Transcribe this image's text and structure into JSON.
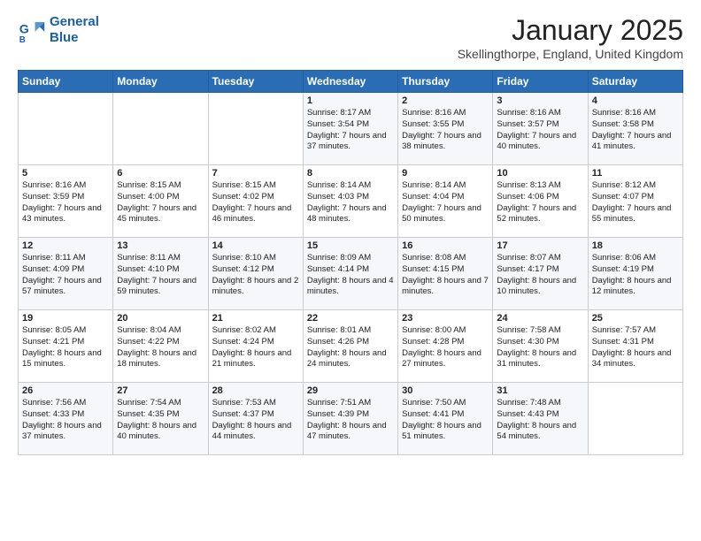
{
  "header": {
    "logo_line1": "General",
    "logo_line2": "Blue",
    "month": "January 2025",
    "location": "Skellingthorpe, England, United Kingdom"
  },
  "days_of_week": [
    "Sunday",
    "Monday",
    "Tuesday",
    "Wednesday",
    "Thursday",
    "Friday",
    "Saturday"
  ],
  "weeks": [
    [
      {
        "day": "",
        "text": ""
      },
      {
        "day": "",
        "text": ""
      },
      {
        "day": "",
        "text": ""
      },
      {
        "day": "1",
        "text": "Sunrise: 8:17 AM\nSunset: 3:54 PM\nDaylight: 7 hours and 37 minutes."
      },
      {
        "day": "2",
        "text": "Sunrise: 8:16 AM\nSunset: 3:55 PM\nDaylight: 7 hours and 38 minutes."
      },
      {
        "day": "3",
        "text": "Sunrise: 8:16 AM\nSunset: 3:57 PM\nDaylight: 7 hours and 40 minutes."
      },
      {
        "day": "4",
        "text": "Sunrise: 8:16 AM\nSunset: 3:58 PM\nDaylight: 7 hours and 41 minutes."
      }
    ],
    [
      {
        "day": "5",
        "text": "Sunrise: 8:16 AM\nSunset: 3:59 PM\nDaylight: 7 hours and 43 minutes."
      },
      {
        "day": "6",
        "text": "Sunrise: 8:15 AM\nSunset: 4:00 PM\nDaylight: 7 hours and 45 minutes."
      },
      {
        "day": "7",
        "text": "Sunrise: 8:15 AM\nSunset: 4:02 PM\nDaylight: 7 hours and 46 minutes."
      },
      {
        "day": "8",
        "text": "Sunrise: 8:14 AM\nSunset: 4:03 PM\nDaylight: 7 hours and 48 minutes."
      },
      {
        "day": "9",
        "text": "Sunrise: 8:14 AM\nSunset: 4:04 PM\nDaylight: 7 hours and 50 minutes."
      },
      {
        "day": "10",
        "text": "Sunrise: 8:13 AM\nSunset: 4:06 PM\nDaylight: 7 hours and 52 minutes."
      },
      {
        "day": "11",
        "text": "Sunrise: 8:12 AM\nSunset: 4:07 PM\nDaylight: 7 hours and 55 minutes."
      }
    ],
    [
      {
        "day": "12",
        "text": "Sunrise: 8:11 AM\nSunset: 4:09 PM\nDaylight: 7 hours and 57 minutes."
      },
      {
        "day": "13",
        "text": "Sunrise: 8:11 AM\nSunset: 4:10 PM\nDaylight: 7 hours and 59 minutes."
      },
      {
        "day": "14",
        "text": "Sunrise: 8:10 AM\nSunset: 4:12 PM\nDaylight: 8 hours and 2 minutes."
      },
      {
        "day": "15",
        "text": "Sunrise: 8:09 AM\nSunset: 4:14 PM\nDaylight: 8 hours and 4 minutes."
      },
      {
        "day": "16",
        "text": "Sunrise: 8:08 AM\nSunset: 4:15 PM\nDaylight: 8 hours and 7 minutes."
      },
      {
        "day": "17",
        "text": "Sunrise: 8:07 AM\nSunset: 4:17 PM\nDaylight: 8 hours and 10 minutes."
      },
      {
        "day": "18",
        "text": "Sunrise: 8:06 AM\nSunset: 4:19 PM\nDaylight: 8 hours and 12 minutes."
      }
    ],
    [
      {
        "day": "19",
        "text": "Sunrise: 8:05 AM\nSunset: 4:21 PM\nDaylight: 8 hours and 15 minutes."
      },
      {
        "day": "20",
        "text": "Sunrise: 8:04 AM\nSunset: 4:22 PM\nDaylight: 8 hours and 18 minutes."
      },
      {
        "day": "21",
        "text": "Sunrise: 8:02 AM\nSunset: 4:24 PM\nDaylight: 8 hours and 21 minutes."
      },
      {
        "day": "22",
        "text": "Sunrise: 8:01 AM\nSunset: 4:26 PM\nDaylight: 8 hours and 24 minutes."
      },
      {
        "day": "23",
        "text": "Sunrise: 8:00 AM\nSunset: 4:28 PM\nDaylight: 8 hours and 27 minutes."
      },
      {
        "day": "24",
        "text": "Sunrise: 7:58 AM\nSunset: 4:30 PM\nDaylight: 8 hours and 31 minutes."
      },
      {
        "day": "25",
        "text": "Sunrise: 7:57 AM\nSunset: 4:31 PM\nDaylight: 8 hours and 34 minutes."
      }
    ],
    [
      {
        "day": "26",
        "text": "Sunrise: 7:56 AM\nSunset: 4:33 PM\nDaylight: 8 hours and 37 minutes."
      },
      {
        "day": "27",
        "text": "Sunrise: 7:54 AM\nSunset: 4:35 PM\nDaylight: 8 hours and 40 minutes."
      },
      {
        "day": "28",
        "text": "Sunrise: 7:53 AM\nSunset: 4:37 PM\nDaylight: 8 hours and 44 minutes."
      },
      {
        "day": "29",
        "text": "Sunrise: 7:51 AM\nSunset: 4:39 PM\nDaylight: 8 hours and 47 minutes."
      },
      {
        "day": "30",
        "text": "Sunrise: 7:50 AM\nSunset: 4:41 PM\nDaylight: 8 hours and 51 minutes."
      },
      {
        "day": "31",
        "text": "Sunrise: 7:48 AM\nSunset: 4:43 PM\nDaylight: 8 hours and 54 minutes."
      },
      {
        "day": "",
        "text": ""
      }
    ]
  ]
}
